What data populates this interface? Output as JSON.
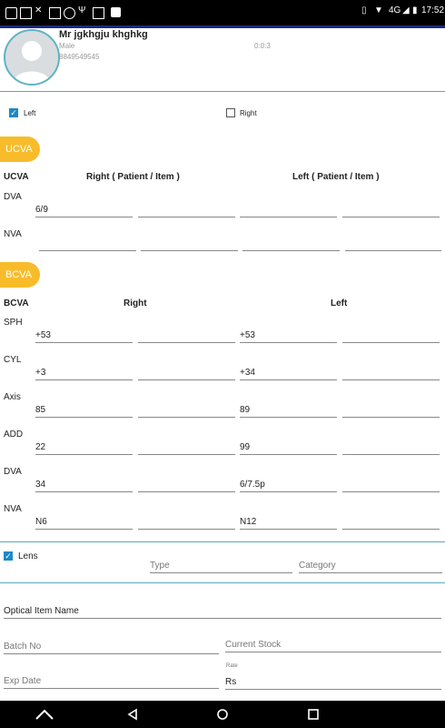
{
  "status": {
    "network": "4G",
    "time": "17:52"
  },
  "patient": {
    "name": "Mr jgkhgju khghkg",
    "gender": "Male",
    "phone": "8849549545",
    "timer": "0:0:3"
  },
  "eye_select": {
    "left_label": "Left",
    "left_checked": true,
    "right_label": "Right",
    "right_checked": false
  },
  "ucva": {
    "pill": "UCVA",
    "col0": "UCVA",
    "right_header": "Right ( Patient / Item )",
    "left_header": "Left ( Patient / Item )",
    "rows": [
      {
        "label": "DVA",
        "values": [
          "6/9",
          "",
          "",
          ""
        ]
      },
      {
        "label": "NVA",
        "values": [
          "",
          "",
          "",
          ""
        ]
      }
    ]
  },
  "bcva": {
    "pill": "BCVA",
    "col0": "BCVA",
    "right_header": "Right",
    "left_header": "Left",
    "rows": [
      {
        "label": "SPH",
        "values": [
          "+53",
          "",
          "+53",
          ""
        ]
      },
      {
        "label": "CYL",
        "values": [
          "+3",
          "",
          "+34",
          ""
        ]
      },
      {
        "label": "Axis",
        "values": [
          "85",
          "",
          "89",
          ""
        ]
      },
      {
        "label": "ADD",
        "values": [
          "22",
          "",
          "99",
          ""
        ]
      },
      {
        "label": "DVA",
        "values": [
          "34",
          "",
          "6/7.5p",
          ""
        ]
      },
      {
        "label": "NVA",
        "values": [
          "N6",
          "",
          "N12",
          ""
        ]
      }
    ]
  },
  "lens": {
    "label": "Lens",
    "checked": true,
    "type_ph": "Type",
    "category_ph": "Category"
  },
  "optical": {
    "item_name_ph": "Optical Item Name",
    "batch_ph": "Batch No",
    "stock_ph": "Current Stock",
    "exp_ph": "Exp Date",
    "rate_label": "Rate",
    "rate_value": "Rs"
  }
}
